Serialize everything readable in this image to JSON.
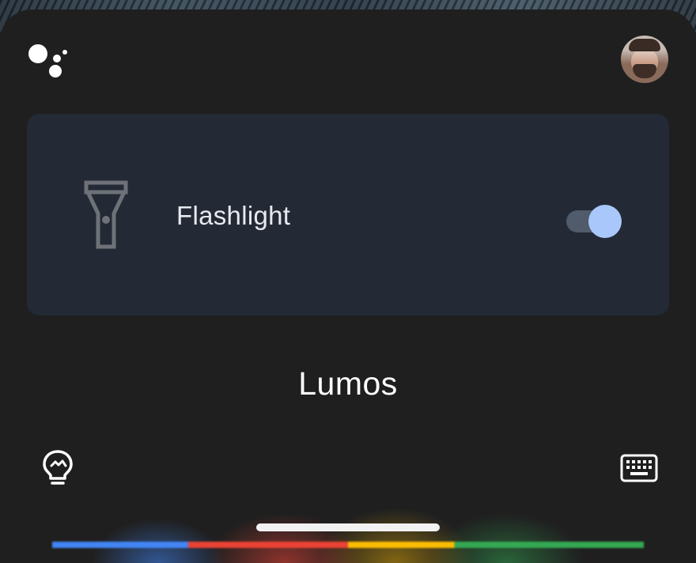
{
  "header": {
    "logo_icon": "google-assistant-logo",
    "avatar_icon": "user-avatar"
  },
  "flashlight_card": {
    "icon": "flashlight-icon",
    "label": "Flashlight",
    "toggle_state": "on",
    "toggle_colors": {
      "track": "#505b6b",
      "thumb": "#a9c7fa"
    }
  },
  "query": {
    "text": "Lumos"
  },
  "bottom_bar": {
    "left_icon": "lightbulb-icon",
    "right_icon": "keyboard-icon"
  },
  "colors": {
    "background": "#1f1f1f",
    "card": "#232a35",
    "google_blue": "#4285f4",
    "google_red": "#ea4335",
    "google_yellow": "#fbbc04",
    "google_green": "#34a853"
  }
}
